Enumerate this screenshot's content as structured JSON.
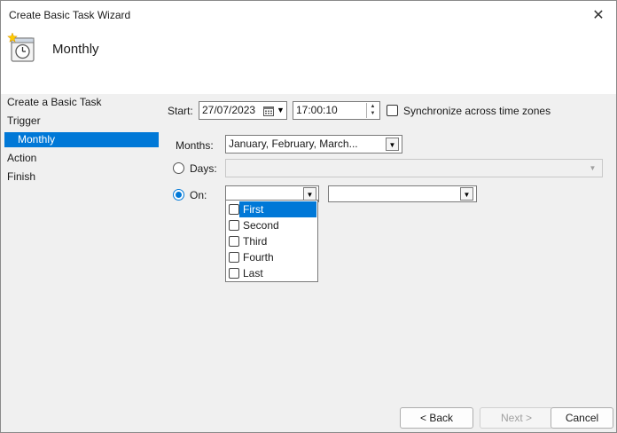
{
  "window": {
    "title": "Create Basic Task Wizard",
    "close_glyph": "✕"
  },
  "header": {
    "step_title": "Monthly"
  },
  "sidebar": {
    "items": [
      {
        "label": "Create a Basic Task"
      },
      {
        "label": "Trigger"
      },
      {
        "label": "Monthly",
        "selected": true
      },
      {
        "label": "Action"
      },
      {
        "label": "Finish"
      }
    ]
  },
  "form": {
    "start_label": "Start:",
    "start_date": "27/07/2023",
    "start_time": "17:00:10",
    "sync_label": "Synchronize across time zones",
    "months_label": "Months:",
    "months_value": "January, February, March...",
    "days_label": "Days:",
    "on_label": "On:",
    "on_value": "",
    "weekday_value": ""
  },
  "popup": {
    "items": [
      {
        "label": "First",
        "highlighted": true
      },
      {
        "label": "Second"
      },
      {
        "label": "Third"
      },
      {
        "label": "Fourth"
      },
      {
        "label": "Last"
      }
    ]
  },
  "buttons": {
    "back": "< Back",
    "next": "Next >",
    "cancel": "Cancel"
  },
  "icons": {
    "task": "calendar-clock-icon",
    "dropdown": "chevron-down-icon"
  },
  "colors": {
    "accent": "#0078d7"
  }
}
